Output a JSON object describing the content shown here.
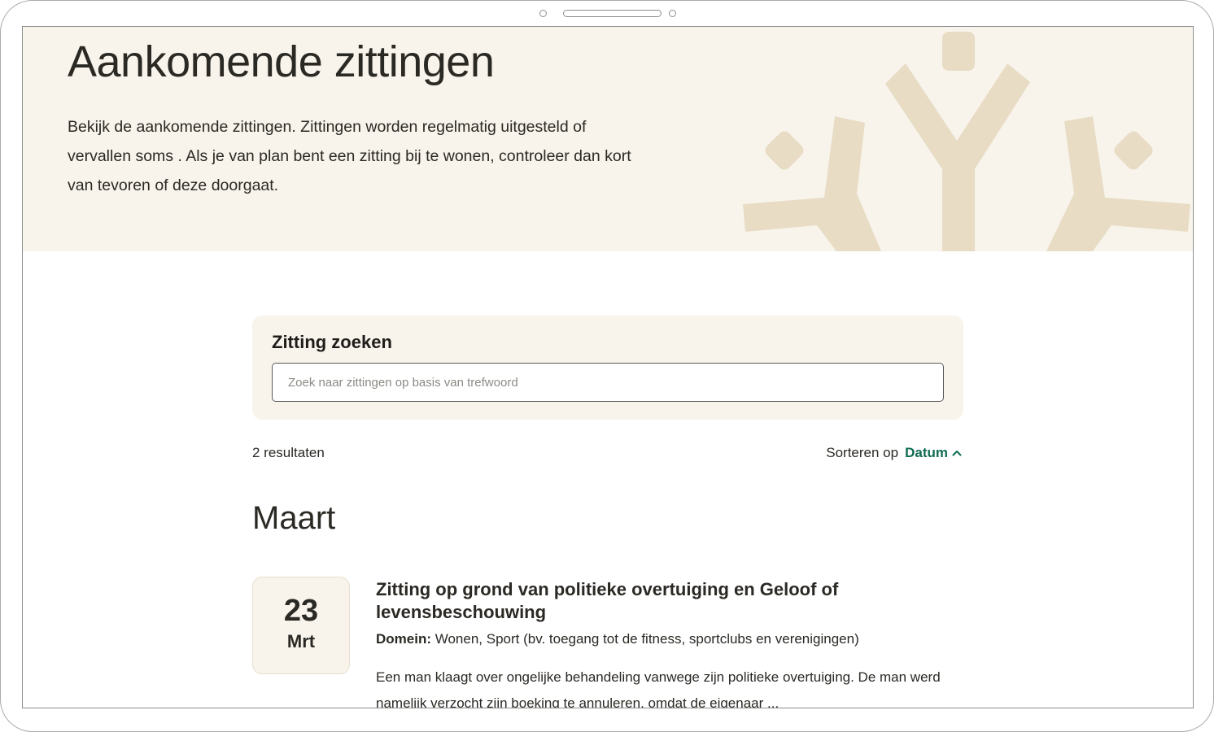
{
  "hero": {
    "title": "Aankomende zittingen",
    "intro": "Bekijk de aankomende zittingen. Zittingen worden regelmatig uitgesteld of vervallen soms . Als je van plan bent een zitting bij te wonen, controleer dan kort van tevoren of deze doorgaat.",
    "background_color": "#f8f4ec",
    "decoration_color": "#e8dcc4",
    "decoration_icon": "tree-branch-logo"
  },
  "search": {
    "title": "Zitting zoeken",
    "value": "",
    "placeholder": "Zoek naar zittingen op basis van trefwoord"
  },
  "results": {
    "count_label": "2 resultaten",
    "sort_label": "Sorteren op",
    "sort_value": "Datum",
    "sort_icon": "chevron-up-icon",
    "accent_color": "#0f6b52"
  },
  "month_heading": "Maart",
  "events": [
    {
      "day": "23",
      "month": "Mrt",
      "title": "Zitting op grond van politieke overtuiging en Geloof of levensbeschouwing",
      "domain_label": "Domein:",
      "domain_value": "Wonen, Sport (bv. toegang tot de fitness, sportclubs en verenigingen)",
      "description": "Een man klaagt over ongelijke behandeling vanwege zijn politieke overtuiging. De man werd namelijk verzocht zijn boeking te annuleren, omdat de eigenaar ..."
    }
  ]
}
